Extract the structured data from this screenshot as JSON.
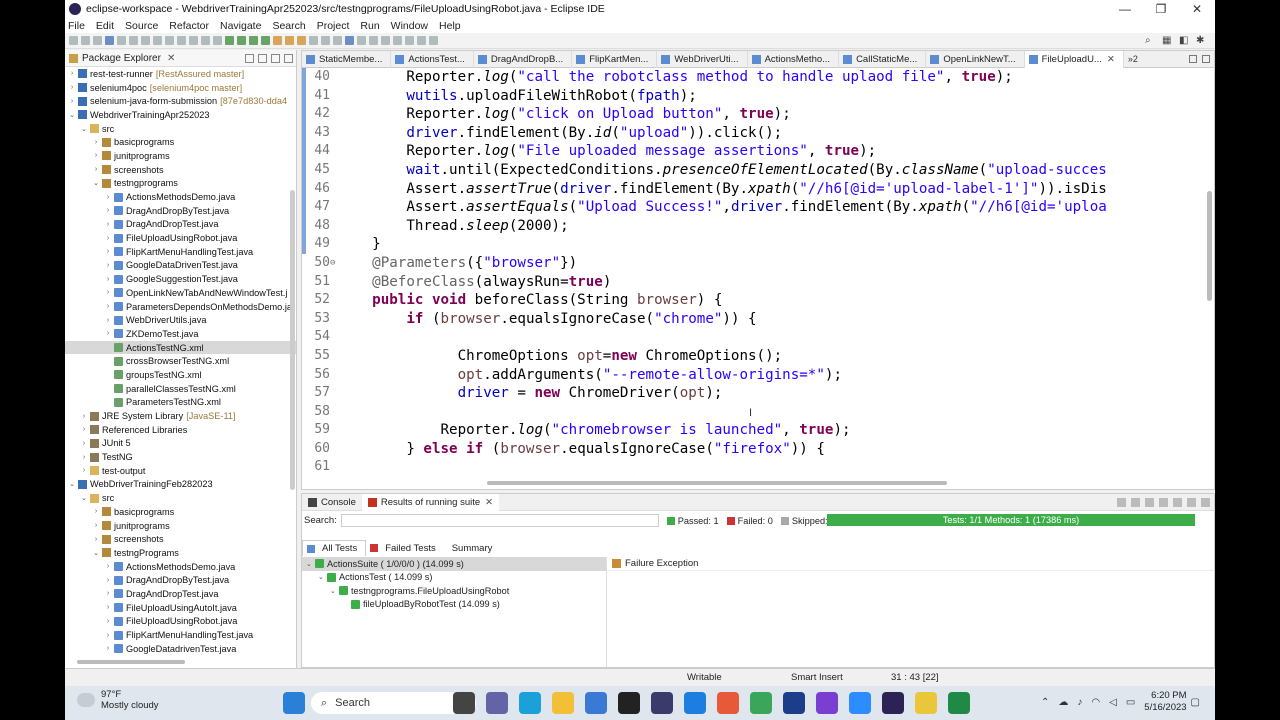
{
  "window": {
    "title": "eclipse-workspace - WebdriverTrainingApr252023/src/testngprograms/FileUploadUsingRobot.java - Eclipse IDE",
    "controls": [
      "—",
      "❐",
      "✕"
    ]
  },
  "menu": [
    "File",
    "Edit",
    "Source",
    "Refactor",
    "Navigate",
    "Search",
    "Project",
    "Run",
    "Window",
    "Help"
  ],
  "package_explorer": {
    "title": "Package Explorer",
    "rows": [
      {
        "indent": 0,
        "arrow": "›",
        "icon": "project",
        "label": "rest-test-runner",
        "extra": "[RestAssured master]"
      },
      {
        "indent": 0,
        "arrow": "›",
        "icon": "project",
        "label": "selenium4poc",
        "extra": "[selenium4poc master]"
      },
      {
        "indent": 0,
        "arrow": "›",
        "icon": "project",
        "label": "selenium-java-form-submission",
        "extra": "[87e7d830-dda4"
      },
      {
        "indent": 0,
        "arrow": "⌄",
        "icon": "project",
        "label": "WebdriverTrainingApr252023",
        "extra": ""
      },
      {
        "indent": 1,
        "arrow": "⌄",
        "icon": "folder",
        "label": "src",
        "extra": ""
      },
      {
        "indent": 2,
        "arrow": "›",
        "icon": "package",
        "label": "basicprograms",
        "extra": ""
      },
      {
        "indent": 2,
        "arrow": "›",
        "icon": "package",
        "label": "junitprograms",
        "extra": ""
      },
      {
        "indent": 2,
        "arrow": "›",
        "icon": "package",
        "label": "screenshots",
        "extra": ""
      },
      {
        "indent": 2,
        "arrow": "⌄",
        "icon": "package",
        "label": "testngprograms",
        "extra": ""
      },
      {
        "indent": 3,
        "arrow": "›",
        "icon": "java",
        "label": "ActionsMethodsDemo.java",
        "extra": ""
      },
      {
        "indent": 3,
        "arrow": "›",
        "icon": "java",
        "label": "DragAndDropByTest.java",
        "extra": ""
      },
      {
        "indent": 3,
        "arrow": "›",
        "icon": "java",
        "label": "DragAndDropTest.java",
        "extra": ""
      },
      {
        "indent": 3,
        "arrow": "›",
        "icon": "java",
        "label": "FileUploadUsingRobot.java",
        "extra": ""
      },
      {
        "indent": 3,
        "arrow": "›",
        "icon": "java",
        "label": "FlipKartMenuHandlingTest.java",
        "extra": ""
      },
      {
        "indent": 3,
        "arrow": "›",
        "icon": "java",
        "label": "GoogleDataDrivenTest.java",
        "extra": ""
      },
      {
        "indent": 3,
        "arrow": "›",
        "icon": "java",
        "label": "GoogleSuggestionTest.java",
        "extra": ""
      },
      {
        "indent": 3,
        "arrow": "›",
        "icon": "java",
        "label": "OpenLinkNewTabAndNewWindowTest.j",
        "extra": ""
      },
      {
        "indent": 3,
        "arrow": "›",
        "icon": "java",
        "label": "ParametersDependsOnMethodsDemo.ja",
        "extra": ""
      },
      {
        "indent": 3,
        "arrow": "›",
        "icon": "java",
        "label": "WebDriverUtils.java",
        "extra": ""
      },
      {
        "indent": 3,
        "arrow": "›",
        "icon": "java",
        "label": "ZKDemoTest.java",
        "extra": ""
      },
      {
        "indent": 3,
        "arrow": "",
        "icon": "xml",
        "label": "ActionsTestNG.xml",
        "extra": "",
        "selected": true
      },
      {
        "indent": 3,
        "arrow": "",
        "icon": "xml",
        "label": "crossBrowserTestNG.xml",
        "extra": ""
      },
      {
        "indent": 3,
        "arrow": "",
        "icon": "xml",
        "label": "groupsTestNG.xml",
        "extra": ""
      },
      {
        "indent": 3,
        "arrow": "",
        "icon": "xml",
        "label": "parallelClassesTestNG.xml",
        "extra": ""
      },
      {
        "indent": 3,
        "arrow": "",
        "icon": "xml",
        "label": "ParametersTestNG.xml",
        "extra": ""
      },
      {
        "indent": 1,
        "arrow": "›",
        "icon": "lib",
        "label": "JRE System Library",
        "extra": "[JavaSE-11]"
      },
      {
        "indent": 1,
        "arrow": "›",
        "icon": "lib",
        "label": "Referenced Libraries",
        "extra": ""
      },
      {
        "indent": 1,
        "arrow": "›",
        "icon": "lib",
        "label": "JUnit 5",
        "extra": ""
      },
      {
        "indent": 1,
        "arrow": "›",
        "icon": "lib",
        "label": "TestNG",
        "extra": ""
      },
      {
        "indent": 1,
        "arrow": "›",
        "icon": "folder",
        "label": "test-output",
        "extra": ""
      },
      {
        "indent": 0,
        "arrow": "⌄",
        "icon": "project",
        "label": "WebDriverTrainingFeb282023",
        "extra": ""
      },
      {
        "indent": 1,
        "arrow": "⌄",
        "icon": "folder",
        "label": "src",
        "extra": ""
      },
      {
        "indent": 2,
        "arrow": "›",
        "icon": "package",
        "label": "basicprograms",
        "extra": ""
      },
      {
        "indent": 2,
        "arrow": "›",
        "icon": "package",
        "label": "junitprograms",
        "extra": ""
      },
      {
        "indent": 2,
        "arrow": "›",
        "icon": "package",
        "label": "screenshots",
        "extra": ""
      },
      {
        "indent": 2,
        "arrow": "⌄",
        "icon": "package",
        "label": "testngPrograms",
        "extra": ""
      },
      {
        "indent": 3,
        "arrow": "›",
        "icon": "java",
        "label": "ActionsMethodsDemo.java",
        "extra": ""
      },
      {
        "indent": 3,
        "arrow": "›",
        "icon": "java",
        "label": "DragAndDropByTest.java",
        "extra": ""
      },
      {
        "indent": 3,
        "arrow": "›",
        "icon": "java",
        "label": "DragAndDropTest.java",
        "extra": ""
      },
      {
        "indent": 3,
        "arrow": "›",
        "icon": "java",
        "label": "FileUploadUsingAutoIt.java",
        "extra": ""
      },
      {
        "indent": 3,
        "arrow": "›",
        "icon": "java",
        "label": "FileUploadUsingRobot.java",
        "extra": ""
      },
      {
        "indent": 3,
        "arrow": "›",
        "icon": "java",
        "label": "FlipKartMenuHandlingTest.java",
        "extra": ""
      },
      {
        "indent": 3,
        "arrow": "›",
        "icon": "java",
        "label": "GoogleDatadrivenTest.java",
        "extra": ""
      }
    ]
  },
  "editor": {
    "tabs": [
      {
        "label": "StaticMembe...",
        "active": false
      },
      {
        "label": "ActionsTest...",
        "active": false
      },
      {
        "label": "DragAndDropB...",
        "active": false
      },
      {
        "label": "FlipKartMen...",
        "active": false
      },
      {
        "label": "WebDriverUti...",
        "active": false
      },
      {
        "label": "ActionsMetho...",
        "active": false
      },
      {
        "label": "CallStaticMe...",
        "active": false
      },
      {
        "label": "OpenLinkNewT...",
        "active": false
      },
      {
        "label": "FileUploadU...",
        "active": true
      }
    ],
    "overflow_label": "»2",
    "lines": [
      {
        "n": "40",
        "marker": "",
        "html": "<span>        Reporter.</span><span class=\"m\">log</span><span>(</span><span class=\"s\">\"call the robotclass method to handle uplaod file\"</span><span>, </span><span class=\"k\">true</span><span>);</span>"
      },
      {
        "n": "41",
        "marker": "",
        "html": "<span>        </span><span class=\"f\">wutils</span><span>.uploadFileWithRobot(</span><span class=\"f\">fpath</span><span>);</span>"
      },
      {
        "n": "42",
        "marker": "",
        "html": "<span>        Reporter.</span><span class=\"m\">log</span><span>(</span><span class=\"s\">\"click on Upload button\"</span><span>, </span><span class=\"k\">true</span><span>);</span>"
      },
      {
        "n": "43",
        "marker": "",
        "html": "<span>        </span><span class=\"f\">driver</span><span>.findElement(By.</span><span class=\"m\">id</span><span>(</span><span class=\"s\">\"upload\"</span><span>)).click();</span>"
      },
      {
        "n": "44",
        "marker": "",
        "html": "<span>        Reporter.</span><span class=\"m\">log</span><span>(</span><span class=\"s\">\"File uploaded message assertions\"</span><span>, </span><span class=\"k\">true</span><span>);</span>"
      },
      {
        "n": "45",
        "marker": "",
        "html": "<span>        </span><span class=\"f\">wait</span><span>.until(ExpectedConditions.</span><span class=\"m\">presenceOfElementLocated</span><span>(By.</span><span class=\"m\">className</span><span>(</span><span class=\"s\">\"upload-succes</span>"
      },
      {
        "n": "46",
        "marker": "",
        "html": "<span>        Assert.</span><span class=\"m\">assertTrue</span><span>(</span><span class=\"f\">driver</span><span>.findElement(By.</span><span class=\"m\">xpath</span><span>(</span><span class=\"s\">\"//h6[@id='upload-label-1']\"</span><span>)).isDis</span>"
      },
      {
        "n": "47",
        "marker": "",
        "html": "<span>        Assert.</span><span class=\"m\">assertEquals</span><span>(</span><span class=\"s\">\"Upload Success!\"</span><span>,</span><span class=\"f\">driver</span><span>.findElement(By.</span><span class=\"m\">xpath</span><span>(</span><span class=\"s\">\"//h6[@id='uploa</span>"
      },
      {
        "n": "48",
        "marker": "",
        "html": "<span>        Thread.</span><span class=\"m\">sleep</span><span>(2000);</span>"
      },
      {
        "n": "49",
        "marker": "",
        "html": "<span>    }</span>"
      },
      {
        "n": "50",
        "marker": "⊖",
        "html": "<span>    </span><span class=\"a\">@Parameters</span><span>({</span><span class=\"s\">\"browser\"</span><span>})</span>"
      },
      {
        "n": "51",
        "marker": "",
        "html": "<span>    </span><span class=\"a\">@BeforeClass</span><span>(alwaysRun=</span><span class=\"k\">true</span><span>)</span>"
      },
      {
        "n": "52",
        "marker": "",
        "html": "<span>    </span><span class=\"k\">public void</span><span> beforeClass(String </span><span class=\"v\">browser</span><span>) {</span>"
      },
      {
        "n": "53",
        "marker": "",
        "html": "<span>        </span><span class=\"k\">if</span><span> (</span><span class=\"v\">browser</span><span>.equalsIgnoreCase(</span><span class=\"s\">\"chrome\"</span><span>)) {</span>"
      },
      {
        "n": "54",
        "marker": "",
        "html": "<span></span>"
      },
      {
        "n": "55",
        "marker": "",
        "html": "<span>              ChromeOptions </span><span class=\"v\">opt</span><span>=</span><span class=\"k\">new</span><span> ChromeOptions();</span>"
      },
      {
        "n": "56",
        "marker": "",
        "html": "<span>              </span><span class=\"v\">opt</span><span>.addArguments(</span><span class=\"s\">\"--remote-allow-origins=*\"</span><span>);</span>"
      },
      {
        "n": "57",
        "marker": "",
        "html": "<span>              </span><span class=\"f\">driver</span><span> = </span><span class=\"k\">new</span><span> ChromeDriver(</span><span class=\"v\">opt</span><span>);</span>"
      },
      {
        "n": "58",
        "marker": "",
        "html": "<span></span>"
      },
      {
        "n": "59",
        "marker": "",
        "html": "<span>            Reporter.</span><span class=\"m\">log</span><span>(</span><span class=\"s\">\"chromebrowser is launched\"</span><span>, </span><span class=\"k\">true</span><span>);</span>"
      },
      {
        "n": "60",
        "marker": "",
        "html": "<span>        } </span><span class=\"k\">else if</span><span> (</span><span class=\"v\">browser</span><span>.equalsIgnoreCase(</span><span class=\"s\">\"firefox\"</span><span>)) {</span>"
      },
      {
        "n": "61",
        "marker": "",
        "html": "<span></span>"
      }
    ]
  },
  "bottom_panel": {
    "tabs": [
      {
        "label": "Console",
        "active": false
      },
      {
        "label": "Results of running suite",
        "active": true
      }
    ],
    "search_label": "Search:",
    "passed": "Passed: 1",
    "failed": "Failed: 0",
    "skipped": "Skipped: 0",
    "progress_label": "Tests: 1/1  Methods: 1 (17386 ms)",
    "progress_fraction": 1.0,
    "result_tabs": [
      {
        "label": "All Tests",
        "active": true
      },
      {
        "label": "Failed Tests",
        "active": false
      },
      {
        "label": "Summary",
        "active": false
      }
    ],
    "tree": [
      {
        "indent": 0,
        "label": "ActionsSuite ( 1/0/0/0 ) (14.099 s)",
        "selected": true
      },
      {
        "indent": 1,
        "label": "ActionsTest ( 14.099 s)",
        "selected": false
      },
      {
        "indent": 2,
        "label": "testngprograms.FileUploadUsingRobot",
        "selected": false
      },
      {
        "indent": 3,
        "label": "fileUploadByRobotTest  (14.099 s)",
        "selected": false
      }
    ],
    "failure_title": "Failure Exception"
  },
  "status": {
    "mode": "Writable",
    "insert": "Smart Insert",
    "position": "31 : 43 [22]"
  },
  "taskbar": {
    "temp": "97°F",
    "weather": "Mostly cloudy",
    "search_label": "Search",
    "time": "6:20 PM",
    "date": "5/16/2023"
  },
  "colors": {
    "passed": "#3dad4a",
    "keyword": "#7f0055",
    "string": "#2a00ff"
  }
}
